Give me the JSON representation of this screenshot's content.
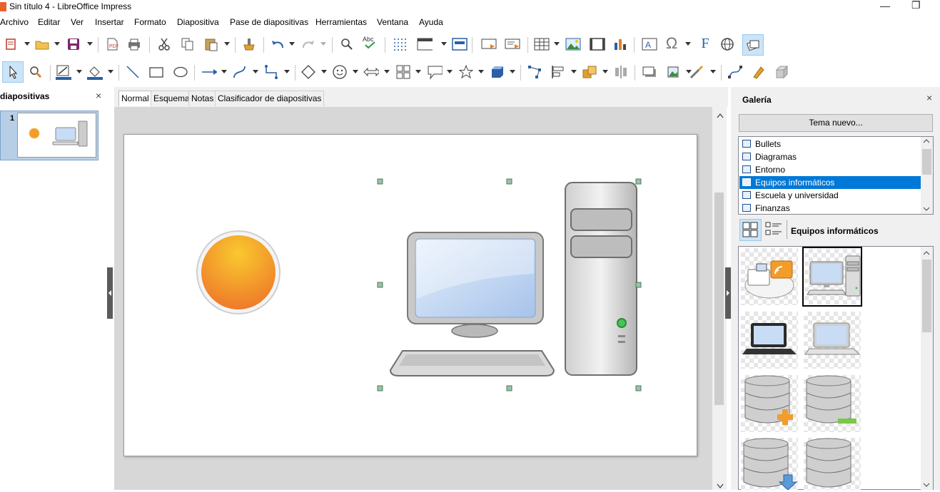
{
  "window": {
    "title": "Sin título 4 - LibreOffice Impress",
    "minimize": "—",
    "restore": "❐"
  },
  "menu": [
    "Archivo",
    "Editar",
    "Ver",
    "Insertar",
    "Formato",
    "Diapositiva",
    "Pase de diapositivas",
    "Herramientas",
    "Ventana",
    "Ayuda"
  ],
  "slides_pane": {
    "title": "Diapositivas",
    "visible_title": "diapositivas",
    "close": "×",
    "slide_number": "1"
  },
  "view_tabs": [
    "Normal",
    "Esquema",
    "Notas",
    "Clasificador de diapositivas"
  ],
  "active_tab": "Normal",
  "gallery": {
    "title": "Galería",
    "close": "×",
    "new_theme_button": "Tema nuevo...",
    "themes": [
      "Bullets",
      "Diagramas",
      "Entorno",
      "Equipos informáticos",
      "Escuela y universidad",
      "Finanzas"
    ],
    "selected_theme": "Equipos informáticos",
    "current_theme_label": "Equipos informáticos",
    "items": [
      "network-cloud-icon",
      "desktop-computer-icon",
      "laptop-black-icon",
      "laptop-silver-icon",
      "database-add-icon",
      "database-remove-icon",
      "database-download-icon",
      "database-icon"
    ],
    "selected_item": "desktop-computer-icon"
  },
  "colors": {
    "selection": "#0078d7",
    "sun_orange": "#f39c2a",
    "screen_blue": "#c8dcf5"
  }
}
